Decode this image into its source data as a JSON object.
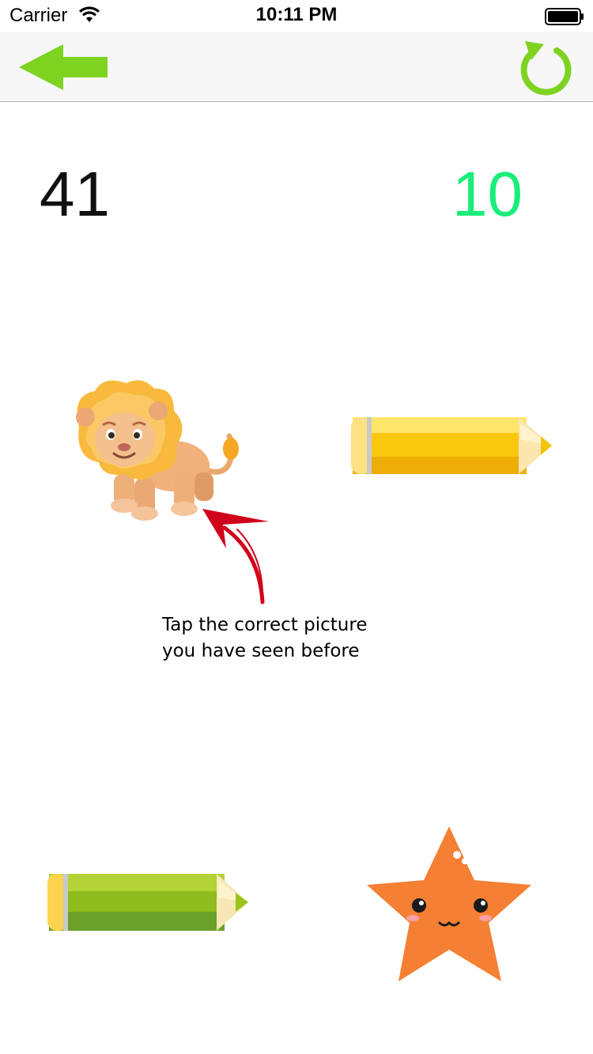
{
  "status_bar": {
    "carrier": "Carrier",
    "time": "10:11 PM",
    "icons": [
      "wifi-icon",
      "battery-icon"
    ]
  },
  "nav_bar": {
    "back_icon": "back-arrow-icon",
    "reload_icon": "reload-icon",
    "accent_color": "#7ed321"
  },
  "scores": {
    "left": "41",
    "right": "10",
    "right_color": "#19ee7a"
  },
  "tiles": [
    {
      "name": "lion",
      "icon": "lion-icon"
    },
    {
      "name": "yellow-pencil",
      "icon": "pencil-icon"
    },
    {
      "name": "green-pencil",
      "icon": "pencil-icon"
    },
    {
      "name": "star",
      "icon": "star-icon"
    }
  ],
  "hint": {
    "line1": "Tap the correct picture",
    "line2": "you have seen before",
    "arrow_color": "#d0021b"
  }
}
